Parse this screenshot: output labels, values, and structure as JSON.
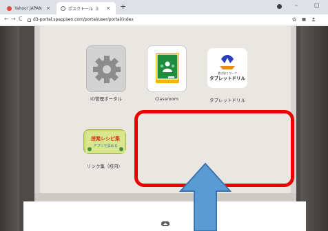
{
  "browser": {
    "tabs": [
      {
        "title": "Yahoo! JAPAN",
        "active": false
      },
      {
        "title": "ポスクトール（IPAD＋Y）",
        "active": true
      }
    ],
    "new_tab": "+",
    "window_controls": {
      "minimize": "–",
      "restore": "□"
    },
    "nav": {
      "back": "←",
      "forward": "→",
      "reload": "C"
    },
    "url": "d3-portal.spappsen.com/portal/user/portal/index"
  },
  "apps": [
    {
      "label": "ID管理ポータル",
      "icon": "gear-icon"
    },
    {
      "label": "Classroom",
      "icon": "google-classroom-icon"
    },
    {
      "label": "タブレットドリル",
      "icon": "tablet-drill-icon",
      "logo_text": "タブレットドリル",
      "logo_sub": "書き取りワーク"
    },
    {
      "label": "リンク集（校内）",
      "icon": "recipe-link-icon",
      "logo_text": "授業レシピ集",
      "logo_sub": "アプリで深める"
    }
  ],
  "annotation": {
    "highlight_color": "#ee0000",
    "arrow_color": "#5b9bd5"
  }
}
